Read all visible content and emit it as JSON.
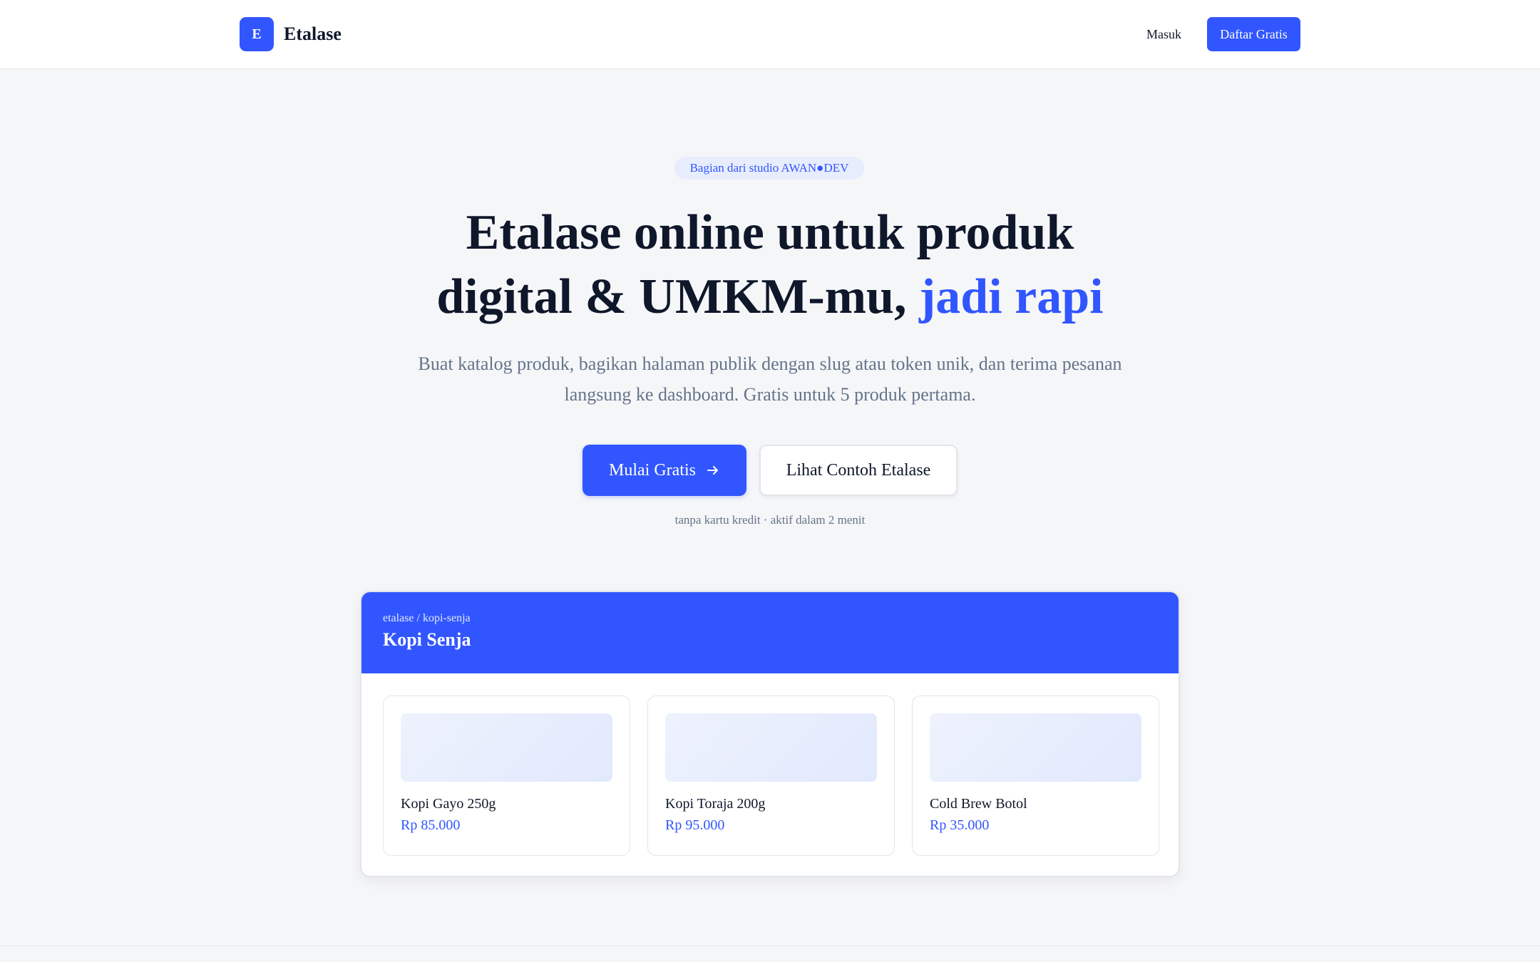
{
  "header": {
    "logo_letter": "E",
    "brand": "Etalase",
    "login_label": "Masuk",
    "signup_label": "Daftar Gratis"
  },
  "hero": {
    "badge": "Bagian dari studio AWAN●DEV",
    "title_line1": "Etalase online untuk produk",
    "title_line2_prefix": "digital & UMKM-mu,",
    "title_line2_accent": "jadi rapi",
    "subtitle": "Buat katalog produk, bagikan halaman publik dengan slug atau token unik, dan terima pesanan langsung ke dashboard. Gratis untuk 5 produk pertama.",
    "cta_primary": "Mulai Gratis",
    "cta_primary_icon": "arrow-right-icon",
    "cta_secondary": "Lihat Contoh Etalase",
    "note": "tanpa kartu kredit · aktif dalam 2 menit"
  },
  "preview": {
    "slug": "etalase / kopi-senja",
    "store_name": "Kopi Senja",
    "products": [
      {
        "name": "Kopi Gayo 250g",
        "price": "Rp 85.000"
      },
      {
        "name": "Kopi Toraja 200g",
        "price": "Rp 95.000"
      },
      {
        "name": "Cold Brew Botol",
        "price": "Rp 35.000"
      }
    ]
  },
  "colors": {
    "accent": "#3156ff",
    "background": "#f5f6f8",
    "text": "#0f172a",
    "muted": "#64748b"
  }
}
